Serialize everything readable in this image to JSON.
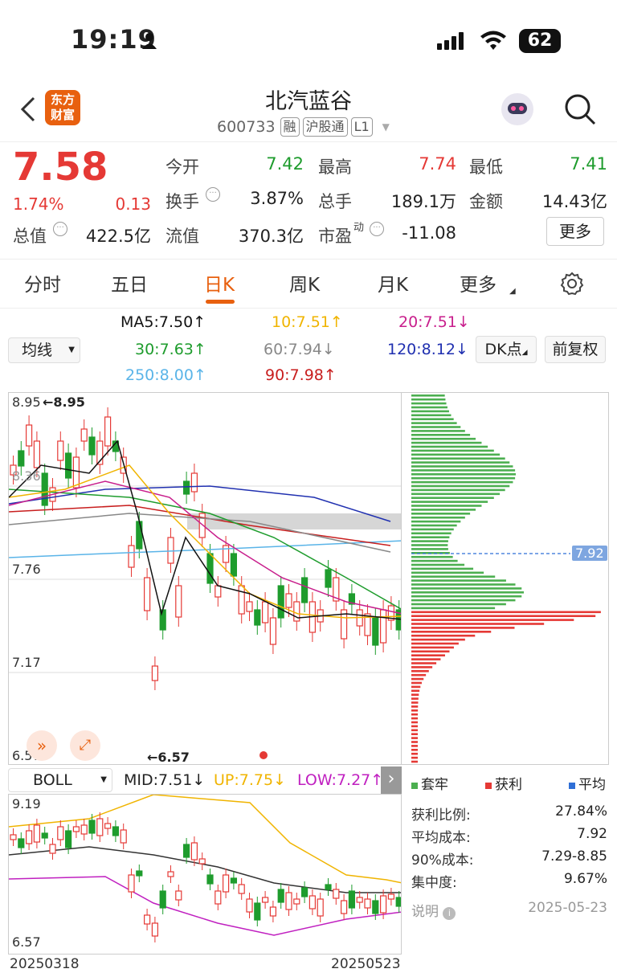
{
  "status": {
    "time": "19:19",
    "battery": "62"
  },
  "header": {
    "name": "北汽蓝谷",
    "code": "600733",
    "tags": [
      "融",
      "沪股通",
      "L1"
    ],
    "logo_line1": "东方",
    "logo_line2": "财富"
  },
  "quote": {
    "price": "7.58",
    "change_pct": "1.74%",
    "change": "0.13",
    "open_label": "今开",
    "open": "7.42",
    "high_label": "最高",
    "high": "7.74",
    "low_label": "最低",
    "low": "7.41",
    "turnover_label": "换手",
    "turnover": "3.87%",
    "volume_label": "总手",
    "volume": "189.1万",
    "amount_label": "金额",
    "amount": "14.43亿",
    "mcap_label": "总值",
    "mcap": "422.5亿",
    "float_label": "流值",
    "float": "370.3亿",
    "pe_label": "市盈",
    "pe_sup": "动",
    "pe": "-11.08",
    "more_label": "更多"
  },
  "tabs": [
    "分时",
    "五日",
    "日K",
    "周K",
    "月K",
    "更多"
  ],
  "ma": {
    "select": "均线",
    "ma5": "MA5:7.50",
    "ma10": "10:7.51",
    "ma20": "20:7.51",
    "ma30": "30:7.63",
    "ma60": "60:7.94",
    "ma120": "120:8.12",
    "ma250": "250:8.00",
    "ma90": "90:7.98",
    "dk": "DK点",
    "adjust": "前复权"
  },
  "main_chart": {
    "y_labels": [
      "8.95",
      "8.36",
      "7.76",
      "7.17",
      "6.57"
    ],
    "max_mark": "8.95",
    "min_mark": "6.57",
    "cost_line": "7.92"
  },
  "boll": {
    "select": "BOLL",
    "mid": "MID:7.51",
    "up": "UP:7.75",
    "low": "LOW:7.27",
    "y_top": "9.19",
    "y_bottom": "6.57",
    "date_start": "20250318",
    "date_end": "20250523"
  },
  "chip": {
    "legend": [
      "套牢",
      "获利",
      "平均"
    ],
    "rows": [
      {
        "label": "获利比例:",
        "value": "27.84%"
      },
      {
        "label": "平均成本:",
        "value": "7.92"
      },
      {
        "label": "90%成本:",
        "value": "7.29-8.85"
      },
      {
        "label": "集中度:",
        "value": "9.67%"
      }
    ],
    "note": "说明",
    "date": "2025-05-23"
  },
  "colors": {
    "up": "#e53935",
    "down": "#1e9c2d",
    "accent": "#e8600f"
  }
}
